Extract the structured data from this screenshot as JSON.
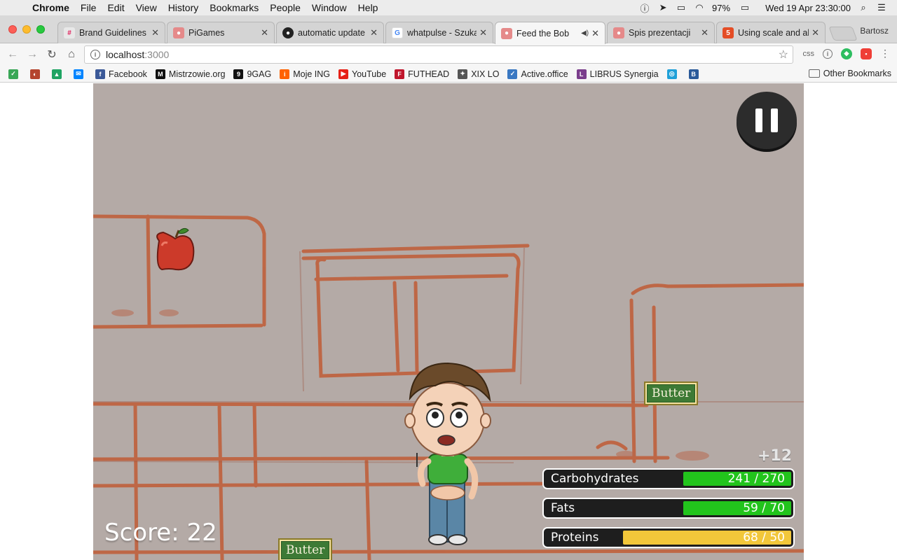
{
  "menubar": {
    "app": "Chrome",
    "items": [
      "File",
      "Edit",
      "View",
      "History",
      "Bookmarks",
      "People",
      "Window",
      "Help"
    ],
    "battery": "97%",
    "datetime": "Wed 19 Apr  23:30:00"
  },
  "tabs": [
    {
      "title": "Brand Guidelines",
      "icon": "slack-icon",
      "color": "#4a154b"
    },
    {
      "title": "PiGames",
      "icon": "pig-icon",
      "color": "#e58a8a"
    },
    {
      "title": "automatic update",
      "icon": "github-icon",
      "color": "#222222"
    },
    {
      "title": "whatpulse - Szuka",
      "icon": "google-icon",
      "color": "#4285f4"
    },
    {
      "title": "Feed the Bob",
      "icon": "pig-icon",
      "color": "#e58a8a"
    },
    {
      "title": "Spis prezentacji",
      "icon": "pig-icon",
      "color": "#e58a8a"
    },
    {
      "title": "Using scale and al",
      "icon": "html5-icon",
      "color": "#e44d26"
    }
  ],
  "profile": "Bartosz",
  "address": {
    "host": "localhost",
    "port": ":3000"
  },
  "extensions": {
    "css": "css"
  },
  "bookmarks": [
    {
      "label": "",
      "icon": "green-ext-icon",
      "color": "#3aa757"
    },
    {
      "label": "",
      "icon": "red-ext-icon",
      "color": "#b5442e"
    },
    {
      "label": "",
      "icon": "drive-icon",
      "color": "#1fa463"
    },
    {
      "label": "",
      "icon": "messenger-icon",
      "color": "#0084ff"
    },
    {
      "label": "Facebook",
      "icon": "facebook-icon",
      "color": "#3b5998"
    },
    {
      "label": "Mistrzowie.org",
      "icon": "mistrzowie-icon",
      "color": "#111111"
    },
    {
      "label": "9GAG",
      "icon": "9gag-icon",
      "color": "#111111"
    },
    {
      "label": "Moje ING",
      "icon": "ing-icon",
      "color": "#ff6200"
    },
    {
      "label": "YouTube",
      "icon": "youtube-icon",
      "color": "#e62117"
    },
    {
      "label": "FUTHEAD",
      "icon": "futhead-icon",
      "color": "#c0162c"
    },
    {
      "label": "XIX LO",
      "icon": "school-icon",
      "color": "#555555"
    },
    {
      "label": "Active.office",
      "icon": "active-office-icon",
      "color": "#3a78c2"
    },
    {
      "label": "LIBRUS Synergia",
      "icon": "librus-icon",
      "color": "#7a3d8c"
    },
    {
      "label": "",
      "icon": "ring-icon",
      "color": "#1fa0d8"
    },
    {
      "label": "",
      "icon": "bl-icon",
      "color": "#2a5a9a"
    }
  ],
  "other_bookmarks": "Other Bookmarks",
  "game": {
    "score_label": "Score: 22",
    "bonus": "+12",
    "falling_items": [
      {
        "label": "Butter"
      },
      {
        "label": "Butter"
      }
    ],
    "stats": [
      {
        "label": "Carbohydrates",
        "value": "241 / 270",
        "fraction": 0.89,
        "color": "#22c41c"
      },
      {
        "label": "Fats",
        "value": "59 / 70",
        "fraction": 0.84,
        "color": "#22c41c"
      },
      {
        "label": "Proteins",
        "value": "68 / 50",
        "fraction": 1.0,
        "color": "#f2c73a"
      }
    ]
  }
}
